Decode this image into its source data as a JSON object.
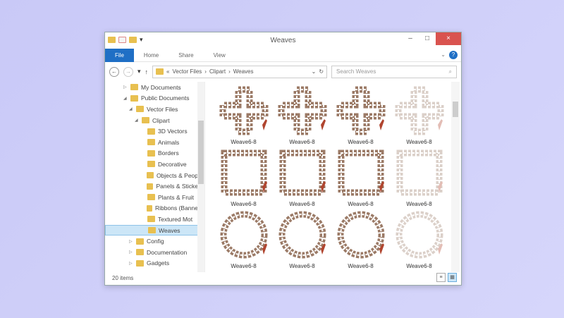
{
  "window": {
    "title": "Weaves",
    "controls": {
      "minimize": "–",
      "maximize": "□",
      "close": "×"
    }
  },
  "ribbon": {
    "tabs": [
      "File",
      "Home",
      "Share",
      "View"
    ],
    "help": "?",
    "expand": "⌄"
  },
  "nav": {
    "back": "←",
    "forward": "→",
    "recent": "▾",
    "up": "↑",
    "path": [
      "«",
      "Vector Files",
      "›",
      "Clipart",
      "›",
      "Weaves"
    ],
    "refresh": "↻",
    "dropdown": "⌄",
    "search_placeholder": "Search Weaves",
    "search_icon": "⌕"
  },
  "tree": [
    {
      "label": "My Documents",
      "level": 1,
      "arrow": "▷"
    },
    {
      "label": "Public Documents",
      "level": 1,
      "arrow": "◢"
    },
    {
      "label": "Vector Files",
      "level": 2,
      "arrow": "◢"
    },
    {
      "label": "Clipart",
      "level": 3,
      "arrow": "◢"
    },
    {
      "label": "3D Vectors",
      "level": 4,
      "arrow": ""
    },
    {
      "label": "Animals",
      "level": 4,
      "arrow": ""
    },
    {
      "label": "Borders",
      "level": 4,
      "arrow": ""
    },
    {
      "label": "Decorative",
      "level": 4,
      "arrow": ""
    },
    {
      "label": "Objects & Peop",
      "level": 4,
      "arrow": ""
    },
    {
      "label": "Panels & Sticke",
      "level": 4,
      "arrow": ""
    },
    {
      "label": "Plants & Fruit",
      "level": 4,
      "arrow": ""
    },
    {
      "label": "Ribbons (Banne",
      "level": 4,
      "arrow": ""
    },
    {
      "label": "Textured Mot",
      "level": 4,
      "arrow": ""
    },
    {
      "label": "Weaves",
      "level": 4,
      "arrow": "",
      "selected": true
    },
    {
      "label": "Config",
      "level": 2,
      "arrow": "▷"
    },
    {
      "label": "Documentation",
      "level": 2,
      "arrow": "▷"
    },
    {
      "label": "Gadgets",
      "level": 2,
      "arrow": "▷"
    }
  ],
  "files": [
    {
      "label": "Weave6-8",
      "shape": "cross"
    },
    {
      "label": "Weave6-8",
      "shape": "cross"
    },
    {
      "label": "Weave6-8",
      "shape": "cross"
    },
    {
      "label": "Weave6-8",
      "shape": "cross",
      "faded": true
    },
    {
      "label": "Weave6-8",
      "shape": "square"
    },
    {
      "label": "Weave6-8",
      "shape": "square"
    },
    {
      "label": "Weave6-8",
      "shape": "square"
    },
    {
      "label": "Weave6-8",
      "shape": "square",
      "faded": true
    },
    {
      "label": "Weave6-8",
      "shape": "ring"
    },
    {
      "label": "Weave6-8",
      "shape": "ring"
    },
    {
      "label": "Weave6-8",
      "shape": "ring"
    },
    {
      "label": "Weave6-8",
      "shape": "ring",
      "faded": true
    }
  ],
  "status": {
    "count": "20 items"
  },
  "colors": {
    "accent": "#1f6fc5",
    "close": "#d9534f",
    "weave": "#9b7a66",
    "folder": "#e8c050"
  }
}
